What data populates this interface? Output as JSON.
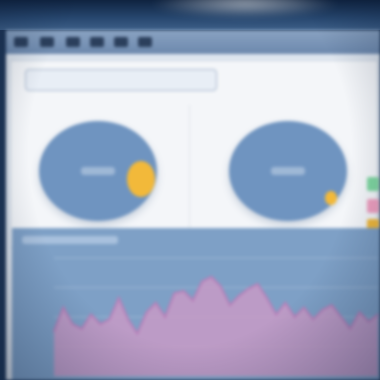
{
  "window": {
    "titlebar_buttons": [
      "menu-icon",
      "folder-icon",
      "back-icon",
      "forward-icon",
      "refresh-icon",
      "settings-icon"
    ]
  },
  "overview": {
    "title": "",
    "subtitle": "",
    "subtitle_right": ""
  },
  "bottom": {
    "title": ""
  },
  "colors": {
    "pie": "#6f94c0",
    "accent_yellow": "#f2b93a",
    "accent_green": "#7fd6a0",
    "accent_pink": "#f0a0c0",
    "area_fill": "#c79ac6",
    "area_stroke": "#b77fb8",
    "bottom_bg": "#7ea0c6"
  },
  "chart_data": [
    {
      "type": "pie",
      "values": [
        90,
        10
      ],
      "colors": [
        "#6f94c0",
        "#f2b93a"
      ]
    },
    {
      "type": "pie",
      "values": [
        96,
        4
      ],
      "colors": [
        "#6f94c0",
        "#f2b93a"
      ]
    },
    {
      "type": "area",
      "x": [
        0,
        1,
        2,
        3,
        4,
        5,
        6,
        7,
        8,
        9,
        10,
        11,
        12,
        13,
        14,
        15,
        16,
        17,
        18,
        19,
        20,
        21,
        22,
        23,
        24,
        25,
        26,
        27,
        28,
        29,
        30,
        31,
        32,
        33,
        34,
        35
      ],
      "values": [
        38,
        58,
        44,
        40,
        52,
        44,
        48,
        66,
        48,
        36,
        54,
        62,
        50,
        70,
        72,
        64,
        80,
        84,
        76,
        60,
        68,
        74,
        78,
        66,
        52,
        62,
        50,
        58,
        48,
        56,
        60,
        50,
        40,
        54,
        46,
        52
      ],
      "ylim": [
        0,
        100
      ],
      "grid": true
    }
  ]
}
